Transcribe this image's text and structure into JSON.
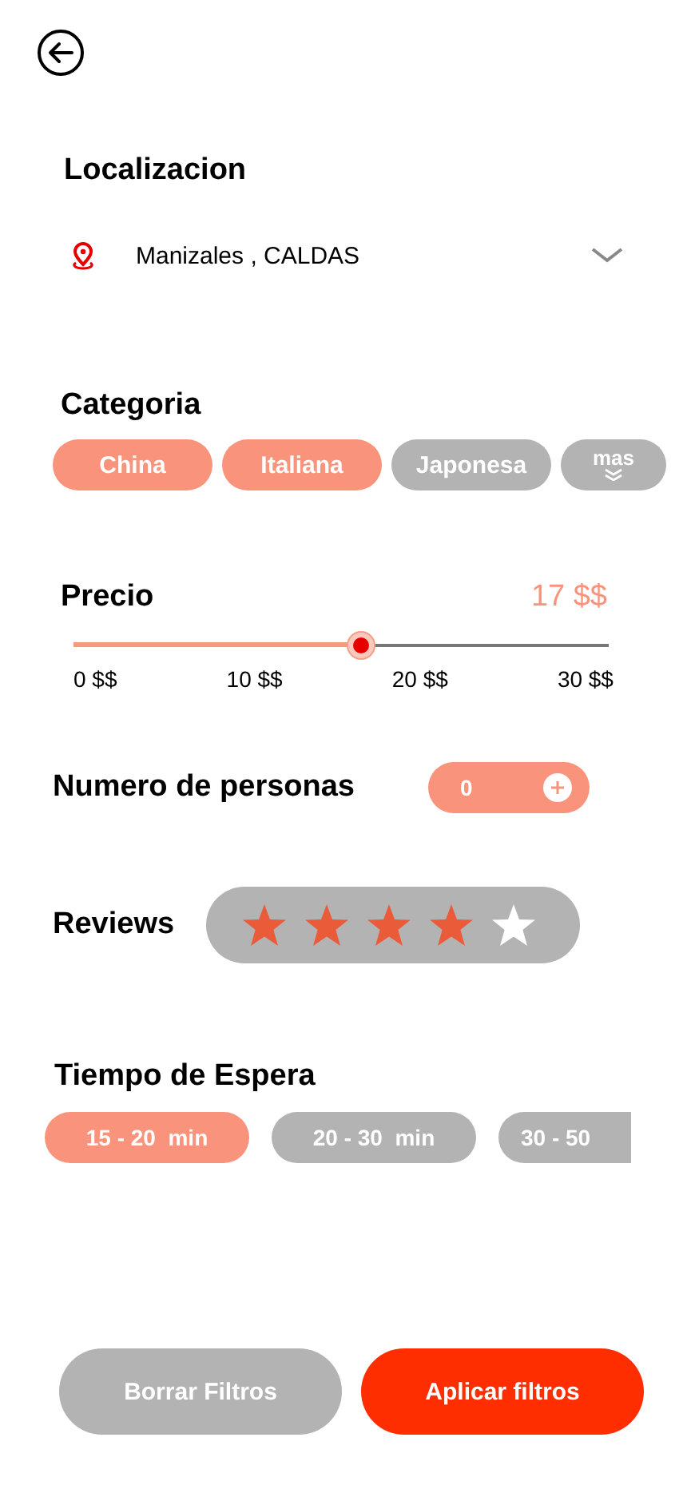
{
  "location": {
    "title": "Localizacion",
    "value": "Manizales , CALDAS"
  },
  "category": {
    "title": "Categoria",
    "chips": [
      {
        "label": "China",
        "selected": true
      },
      {
        "label": "Italiana",
        "selected": true
      },
      {
        "label": "Japonesa",
        "selected": false
      }
    ],
    "more": "mas"
  },
  "price": {
    "title": "Precio",
    "reading": "17 $$",
    "level": 0.537,
    "ticks": [
      "0 $$",
      "10 $$",
      "20 $$",
      "30 $$"
    ]
  },
  "people": {
    "title": "Numero de personas",
    "value": "0"
  },
  "reviews": {
    "title": "Reviews",
    "stars": 4
  },
  "wait_time": {
    "title": "Tiempo de Espera",
    "chips": [
      {
        "label": "15 - 20  min",
        "selected": true
      },
      {
        "label": "20 - 30  min",
        "selected": false
      },
      {
        "label": "30 - 50",
        "selected": false
      }
    ]
  },
  "buttons": [
    {
      "label": "Borrar Filtros",
      "kind": "secondary"
    },
    {
      "label": "Aplicar filtros",
      "kind": "primary"
    }
  ]
}
